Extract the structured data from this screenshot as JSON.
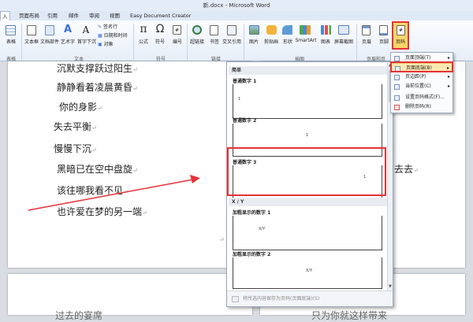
{
  "window": {
    "title": "新.docx - Microsoft Word"
  },
  "tabs": {
    "items": [
      {
        "label": "入",
        "active": true
      },
      {
        "label": "页面布局"
      },
      {
        "label": "引用"
      },
      {
        "label": "邮件"
      },
      {
        "label": "审阅"
      },
      {
        "label": "视图"
      },
      {
        "label": "Easy Document Creator"
      }
    ]
  },
  "ribbon": {
    "tables": {
      "table": "表格",
      "group": "表格"
    },
    "text": {
      "textbox": "文本框",
      "docparts": "文档部件",
      "wordart": "艺术字",
      "dropcap": "首字下沉",
      "signature": "签名行",
      "datetime": "日期和时间",
      "object": "对象",
      "group": "文本"
    },
    "symbols": {
      "equation": "公式",
      "symbol": "符号",
      "number": "编号",
      "group": "符号"
    },
    "links": {
      "hyperlink": "超链接",
      "bookmark": "书签",
      "crossref": "交叉引用",
      "group": "链接"
    },
    "illustrations": {
      "picture": "图片",
      "clipart": "剪贴画",
      "shapes": "形状",
      "smartart": "SmartArt",
      "chart": "图表",
      "screenshot": "屏幕截图",
      "group": "插图"
    },
    "headerfooter": {
      "header": "页眉",
      "footer": "页脚",
      "pagenum": "页码",
      "group": "页眉和页"
    }
  },
  "document": {
    "lines": [
      "沉默支撑跃过阳生",
      "静静看着凌晨黄昏",
      "你的身影",
      "失去平衡",
      "慢慢下沉",
      "黑暗已在空中盘旋",
      "该往哪我看不见",
      "也许爱在梦的另一端"
    ],
    "right_fragment": "去去",
    "paragraph_mark": "↵",
    "bottom_left_partial": "过去的宴席",
    "bottom_right_partial": "只为你就这样带来"
  },
  "gallery": {
    "section_simple": "简单",
    "section_xy": "X / Y",
    "items": [
      {
        "name": "普通数字 1",
        "num": "1"
      },
      {
        "name": "普通数字 2",
        "num": "1"
      },
      {
        "name": "普通数字 3",
        "num": "1"
      },
      {
        "name": "加粗显示的数字 1",
        "num": "X/Y"
      },
      {
        "name": "加粗显示的数字 2",
        "num": "X/Y"
      }
    ],
    "footer": "将所选内容保存为页码(页面底端)(S)"
  },
  "pagenum_menu": {
    "items": [
      {
        "label": "页面顶端(T)",
        "has_sub": true
      },
      {
        "label": "页面底端(B)",
        "has_sub": true,
        "highlighted": true
      },
      {
        "label": "页边距(P)",
        "has_sub": true
      },
      {
        "label": "当前位置(C)",
        "has_sub": true
      },
      {
        "label": "设置页码格式(F)..."
      },
      {
        "label": "删除页码(R)"
      }
    ]
  },
  "colors": {
    "highlight": "#e53238",
    "arrow": "#e53238",
    "menu_hover": "#fde9b0"
  }
}
